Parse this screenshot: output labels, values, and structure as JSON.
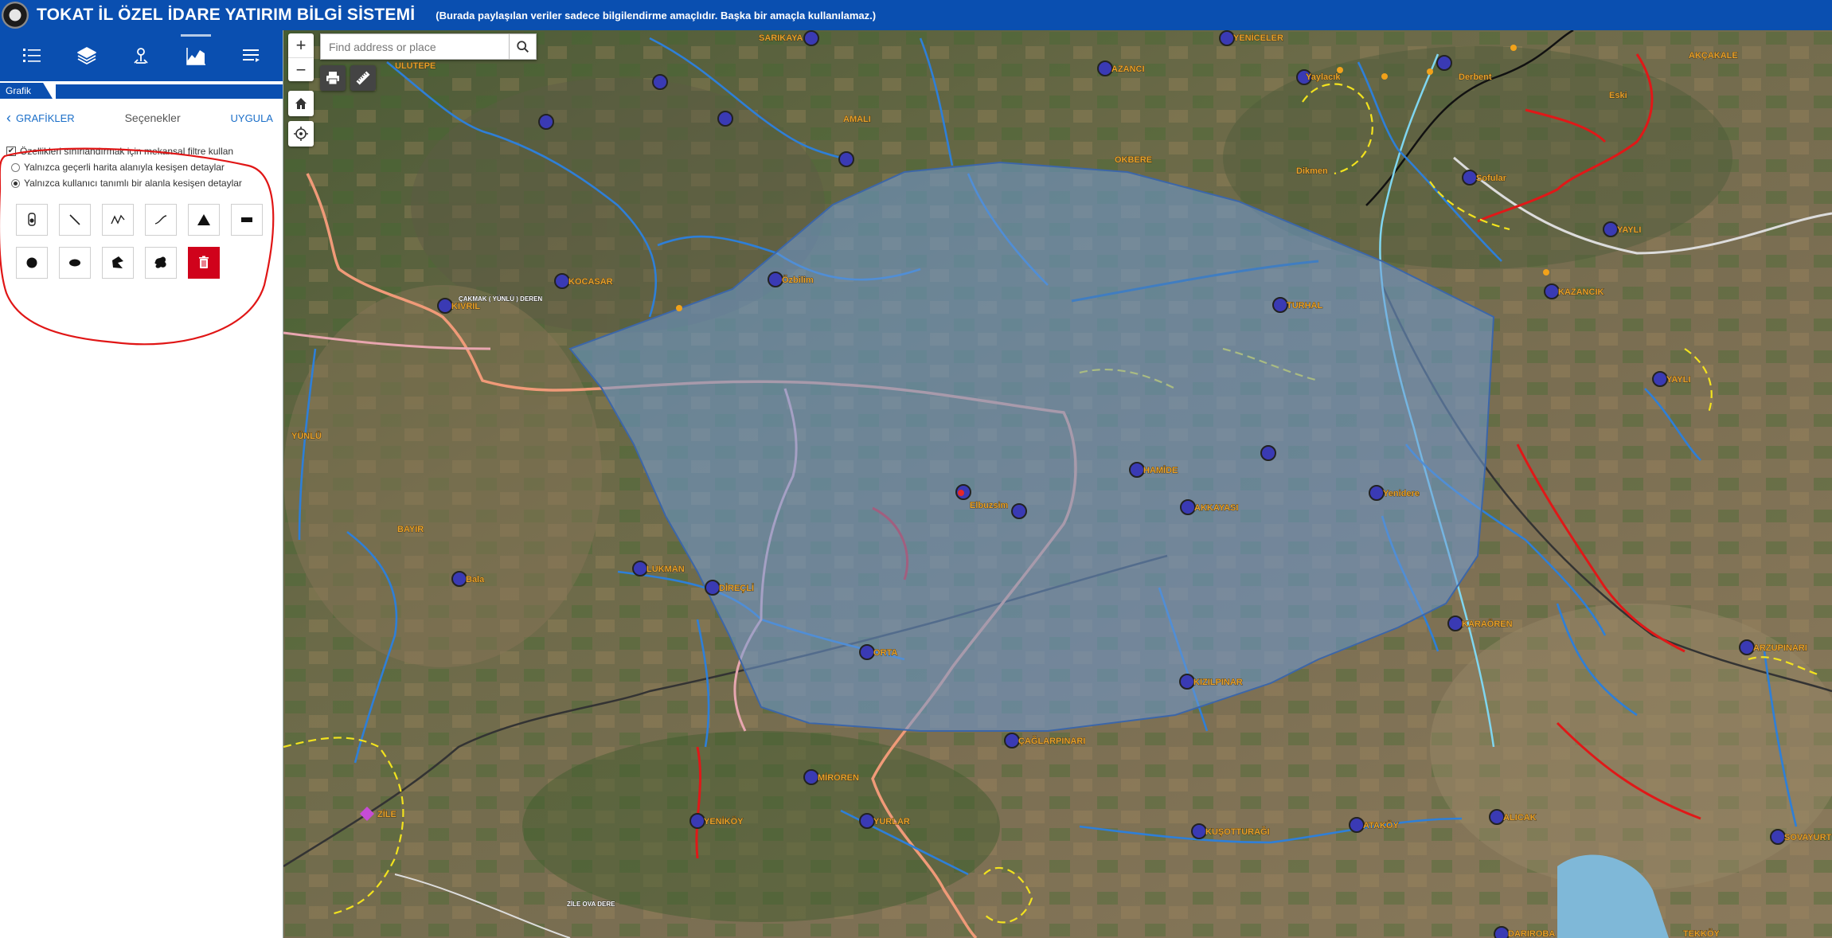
{
  "header": {
    "title": "TOKAT İL ÖZEL İDARE YATIRIM BİLGİ SİSTEMİ",
    "note": "(Burada paylaşılan veriler sadece bilgilendirme amaçlıdır. Başka bir amaçla kullanılamaz.)"
  },
  "toolbar": {
    "items": [
      "list-icon",
      "layers-icon",
      "measure-icon",
      "chart-icon",
      "menu-icon"
    ]
  },
  "panel": {
    "tab_label": "Grafik",
    "back_label": "GRAFİKLER",
    "title": "Seçenekler",
    "apply_label": "UYGULA",
    "spatial_filter_label": "Özellikleri sınırlandırmak için mekansal filtre kullan",
    "option_extent": "Yalnızca geçerli harita alanıyla kesişen detaylar",
    "option_custom": "Yalnızca kullanıcı tanımlı bir alanla kesişen detaylar",
    "spatial_filter_checked": true,
    "selected_option": "custom"
  },
  "map": {
    "search_placeholder": "Find address or place",
    "zoom_in": "+",
    "zoom_out": "−",
    "labels": {
      "sarikaya": "SARIKAYA",
      "azanci": "AZANCI",
      "yeniceler": "YENİCELER",
      "ulutepe": "ULUTEPE",
      "amali": "AMALI",
      "okbere": "OKBERE",
      "eski": "Eski",
      "dikmen": "Dikmen",
      "sofular": "Sofular",
      "yaylacik": "Yaylacık",
      "akcakale": "AKÇAKALE",
      "derbent": "Derbent",
      "cakmak": "ÇAKMAK ( YÜNLÜ ) DEREN",
      "kocasar": "KOCASAR",
      "ozbilim": "Özbilim",
      "kivril": "KIVRIL",
      "turhal": "TURHAL",
      "kazancik": "KAZANCIK",
      "yayli": "YAYLI",
      "yunlu": "YÜNLÜ",
      "hamide": "HAMİDE",
      "elbuzsim": "Elbuzsim",
      "akkayasi": "AKKAYASI",
      "yenidere": "Yenidere",
      "bayir": "BAYIR",
      "bala": "Bala",
      "lukman": "LUKMAN",
      "direcli": "DİREÇLİ",
      "karaoren": "KARAÖREN",
      "kizilpinar": "KIZILPINAR",
      "orta": "ORTA",
      "sagalpinari": "ÇAĞLARPINARI",
      "arzupinari": "ARZUPINARI",
      "miroren": "MİRÖREN",
      "zile": "ZİLE",
      "yenikoy": "YENİKÖY",
      "yurlar": "YURLAR",
      "kusottaragi": "KUŞOTTURAĞI",
      "atakoy": "ATAKÖY",
      "alicak": "ALICAK",
      "sovayurt": "SOVAYURT",
      "dariroba": "DARIROBA",
      "tekkoy": "TEKKÖY",
      "zile_ova": "ZİLE OVA DERE"
    }
  }
}
